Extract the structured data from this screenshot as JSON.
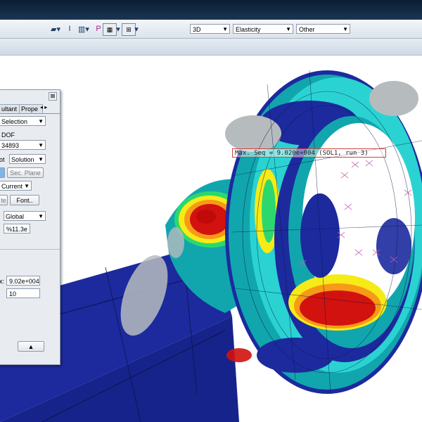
{
  "toolbar": {
    "icons": [
      "shape-icon",
      "dimension-icon",
      "chart-icon",
      "pointer-icon",
      "grid-icon",
      "node-icon"
    ],
    "view_mode": "3D",
    "analysis_type": "Elasticity",
    "other": "Other"
  },
  "panel": {
    "close_glyph": "⊠",
    "tabs": [
      "ultant",
      "Prope"
    ],
    "tab_arrows": "◂ ▸",
    "selection": "Selection",
    "dof_label": "DOF",
    "node_value": "34893",
    "plot_label": "ot",
    "plot_value": "Solution",
    "sec_plane_label": "Sec. Plane",
    "current_value": "Current",
    "te_label": "te",
    "font_label": "Font..",
    "coord_value": "Global",
    "format_value": "%11.3e",
    "max_label": "x:",
    "max_value": "9.02e+004",
    "levels_value": "10",
    "up_glyph": "▲"
  },
  "viewport": {
    "annotation": "Max. Seq =  9.020e+004 (SOL1, run 3)",
    "colors": {
      "deep_blue": "#1c2a9e",
      "teal": "#11a6ad",
      "cyan": "#2ad3d1",
      "green": "#2cd86e",
      "yellow": "#f6ea17",
      "orange": "#f79a18",
      "red": "#d2120e",
      "grey": "#b6bcbe"
    }
  }
}
